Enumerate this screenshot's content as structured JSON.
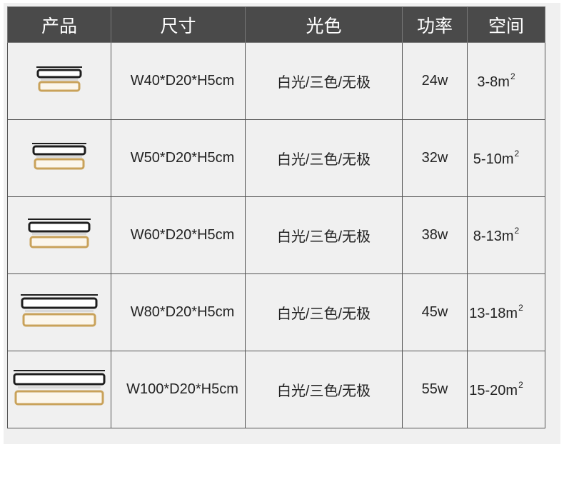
{
  "headers": {
    "product": "产品",
    "size": "尺寸",
    "light_color": "光色",
    "power": "功率",
    "space": "空间"
  },
  "rows": [
    {
      "size": "W40*D20*H5cm",
      "light_color": "白光/三色/无极",
      "power": "24w",
      "space": "3-8m",
      "space_sup": "2"
    },
    {
      "size": "W50*D20*H5cm",
      "light_color": "白光/三色/无极",
      "power": "32w",
      "space": "5-10m",
      "space_sup": "2"
    },
    {
      "size": "W60*D20*H5cm",
      "light_color": "白光/三色/无极",
      "power": "38w",
      "space": "8-13m",
      "space_sup": "2"
    },
    {
      "size": "W80*D20*H5cm",
      "light_color": "白光/三色/无极",
      "power": "45w",
      "space": "13-18m",
      "space_sup": "2"
    },
    {
      "size": "W100*D20*H5cm",
      "light_color": "白光/三色/无极",
      "power": "55w",
      "space": "15-20m",
      "space_sup": "2"
    }
  ],
  "colors": {
    "header_bg": "#4a4a4a",
    "cell_bg": "#f0f0f0",
    "lamp_black": "#1e1e1e",
    "lamp_gold": "#c9a25a"
  }
}
